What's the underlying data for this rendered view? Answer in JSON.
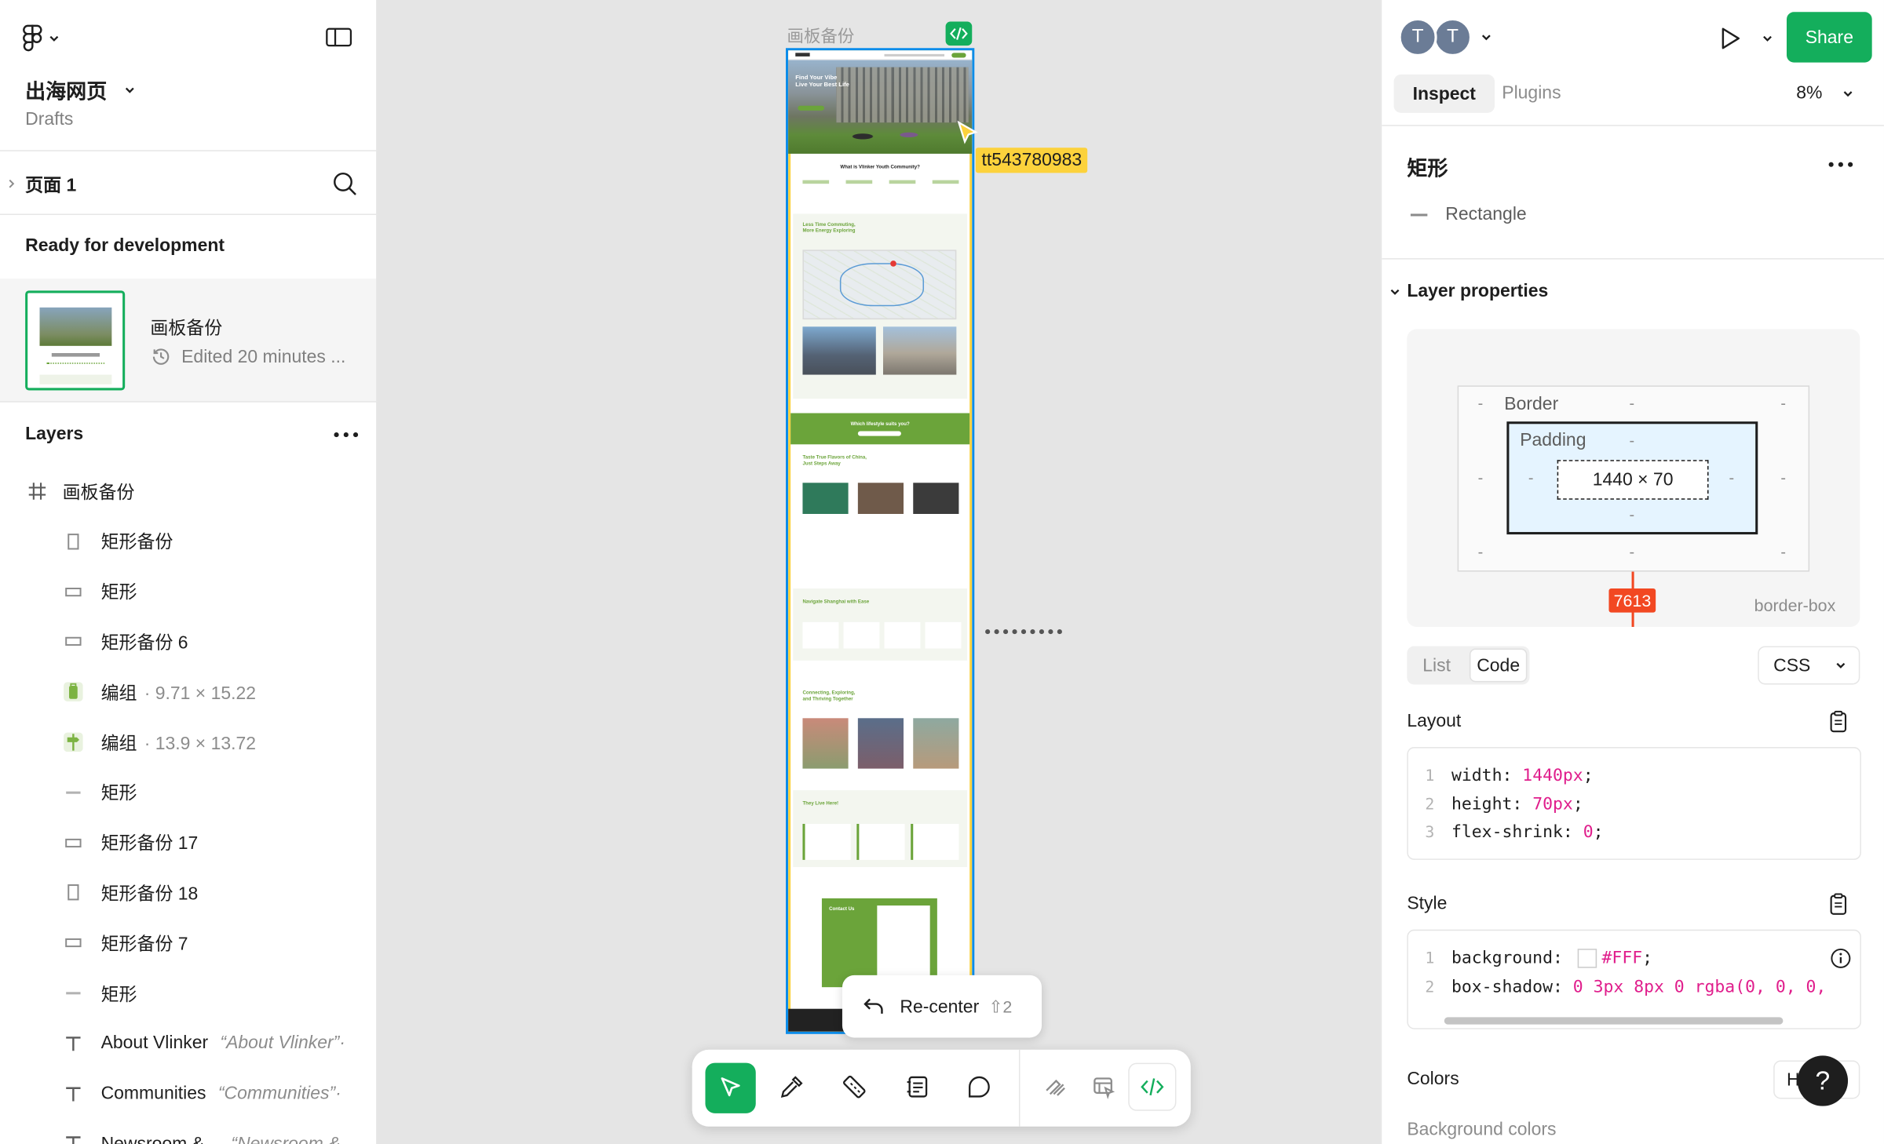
{
  "file": {
    "name": "出海网页",
    "location": "Drafts"
  },
  "page": {
    "name": "页面 1"
  },
  "ready_section": {
    "title": "Ready for development",
    "frame_name": "画板备份",
    "edited": "Edited 20 minutes ..."
  },
  "layers": {
    "title": "Layers",
    "items": [
      {
        "name": "画板备份",
        "meta": "",
        "alt": "",
        "icon": "frame-hash-icon"
      },
      {
        "name": "矩形备份",
        "meta": "",
        "alt": "",
        "icon": "rectangle-tall-icon"
      },
      {
        "name": "矩形",
        "meta": "",
        "alt": "",
        "icon": "rectangle-wide-icon"
      },
      {
        "name": "矩形备份 6",
        "meta": "",
        "alt": "",
        "icon": "rectangle-wide-icon"
      },
      {
        "name": "编组",
        "meta": "· 9.71 × 15.22",
        "alt": "",
        "icon": "luggage-group-icon"
      },
      {
        "name": "编组",
        "meta": "· 13.9 × 13.72",
        "alt": "",
        "icon": "signpost-group-icon"
      },
      {
        "name": "矩形",
        "meta": "",
        "alt": "",
        "icon": "line-rectangle-icon"
      },
      {
        "name": "矩形备份 17",
        "meta": "",
        "alt": "",
        "icon": "rectangle-wide-icon"
      },
      {
        "name": "矩形备份 18",
        "meta": "",
        "alt": "",
        "icon": "rectangle-tall-icon"
      },
      {
        "name": "矩形备份 7",
        "meta": "",
        "alt": "",
        "icon": "rectangle-wide-icon"
      },
      {
        "name": "矩形",
        "meta": "",
        "alt": "",
        "icon": "line-rectangle-icon"
      },
      {
        "name": "About Vlinker",
        "meta": "",
        "alt": "“About Vlinker”·",
        "icon": "text-icon"
      },
      {
        "name": "Communities",
        "meta": "",
        "alt": "“Communities”·",
        "icon": "text-icon"
      },
      {
        "name": "Newsroom &...",
        "meta": "",
        "alt": "“Newsroom &...",
        "icon": "text-icon"
      }
    ]
  },
  "canvas": {
    "frame_label": "画板备份",
    "user_label": "tt543780983",
    "recenter": {
      "label": "Re-center",
      "shortcut": "⇧2"
    },
    "mock": {
      "hero": "Find Your Vibe\nLive Your Best Life",
      "community": "What is Vlinker Youth Community?",
      "commuting": "Less Time Commuting,\nMore Energy Exploring",
      "lifestyle": "Which lifestyle suits you?",
      "flavors": "Taste True Flavors of China,\nJust Steps Away",
      "navigate": "Navigate Shanghai with Ease",
      "connecting": "Connecting, Exploring,\nand Thriving Together",
      "live": "They Live Here!",
      "contact": "Contact Us"
    }
  },
  "toolbar": {
    "tools": [
      "move-tool",
      "eyedropper-tool",
      "ruler-tool",
      "annotate-tool",
      "comment-tool",
      "draw-tool",
      "dev-resources-tool",
      "code-tool"
    ]
  },
  "header": {
    "avatars": [
      "T",
      "T"
    ],
    "share": "Share"
  },
  "tabs": {
    "inspect": "Inspect",
    "plugins": "Plugins",
    "zoom": "8%"
  },
  "selection": {
    "name": "矩形",
    "type": "Rectangle"
  },
  "layer_properties": {
    "title": "Layer properties",
    "border": "Border",
    "padding": "Padding",
    "size": "1440 × 70",
    "dash": "-",
    "distance": "7613",
    "box_sizing": "border-box"
  },
  "code_view": {
    "list": "List",
    "code": "Code",
    "language": "CSS"
  },
  "layout": {
    "title": "Layout",
    "lines": [
      {
        "prop": "width:",
        "val": "1440px"
      },
      {
        "prop": "height:",
        "val": "70px"
      },
      {
        "prop": "flex-shrink:",
        "val": "0"
      }
    ]
  },
  "style": {
    "title": "Style",
    "lines": [
      {
        "prop": "background:",
        "val": "#FFF"
      },
      {
        "prop": "box-shadow:",
        "val": "0 3px 8px 0 rgba(0, 0, 0,"
      }
    ]
  },
  "colors": {
    "title": "Colors",
    "bg_title": "Background colors",
    "format": "H"
  },
  "theme": {
    "accent": "#14ae5c",
    "brand_green": "#6ba43a",
    "highlight": "#fcd23c",
    "measure_red": "#f24822",
    "blue_frame": "#0c8ce9"
  }
}
